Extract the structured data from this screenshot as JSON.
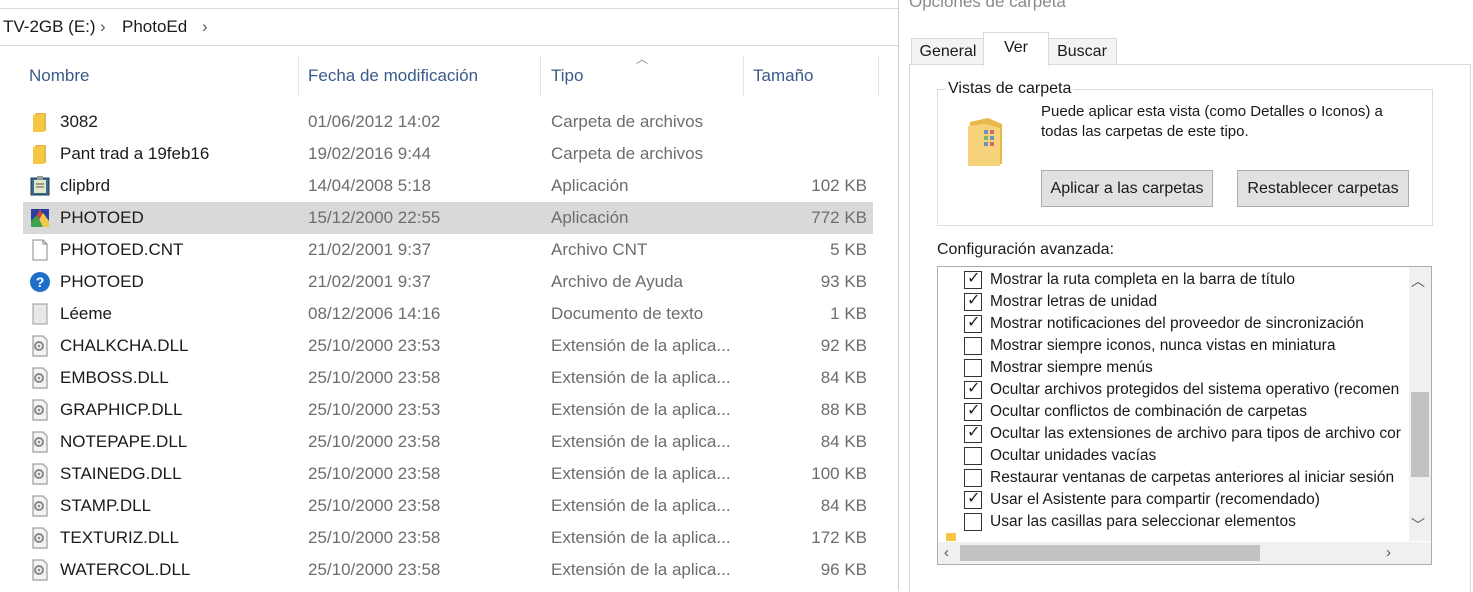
{
  "breadcrumb": {
    "drive": "TV-2GB (E:)",
    "folder": "PhotoEd"
  },
  "columns": {
    "name": "Nombre",
    "date": "Fecha de modificación",
    "type": "Tipo",
    "size": "Tamaño"
  },
  "files": [
    {
      "name": "3082",
      "date": "01/06/2012 14:02",
      "type": "Carpeta de archivos",
      "size": "",
      "icon": "folder-icon"
    },
    {
      "name": "Pant trad a 19feb16",
      "date": "19/02/2016 9:44",
      "type": "Carpeta de archivos",
      "size": "",
      "icon": "folder-icon"
    },
    {
      "name": "clipbrd",
      "date": "14/04/2008 5:18",
      "type": "Aplicación",
      "size": "102 KB",
      "icon": "clipboard-app-icon"
    },
    {
      "name": "PHOTOED",
      "date": "15/12/2000 22:55",
      "type": "Aplicación",
      "size": "772 KB",
      "icon": "photoed-app-icon"
    },
    {
      "name": "PHOTOED.CNT",
      "date": "21/02/2001 9:37",
      "type": "Archivo CNT",
      "size": "5 KB",
      "icon": "blank-file-icon"
    },
    {
      "name": "PHOTOED",
      "date": "21/02/2001 9:37",
      "type": "Archivo de Ayuda",
      "size": "93 KB",
      "icon": "help-icon"
    },
    {
      "name": "Léeme",
      "date": "08/12/2006 14:16",
      "type": "Documento de texto",
      "size": "1 KB",
      "icon": "text-file-icon"
    },
    {
      "name": "CHALKCHA.DLL",
      "date": "25/10/2000 23:53",
      "type": "Extensión de la aplica...",
      "size": "92 KB",
      "icon": "dll-file-icon"
    },
    {
      "name": "EMBOSS.DLL",
      "date": "25/10/2000 23:58",
      "type": "Extensión de la aplica...",
      "size": "84 KB",
      "icon": "dll-file-icon"
    },
    {
      "name": "GRAPHICP.DLL",
      "date": "25/10/2000 23:53",
      "type": "Extensión de la aplica...",
      "size": "88 KB",
      "icon": "dll-file-icon"
    },
    {
      "name": "NOTEPAPE.DLL",
      "date": "25/10/2000 23:58",
      "type": "Extensión de la aplica...",
      "size": "84 KB",
      "icon": "dll-file-icon"
    },
    {
      "name": "STAINEDG.DLL",
      "date": "25/10/2000 23:58",
      "type": "Extensión de la aplica...",
      "size": "100 KB",
      "icon": "dll-file-icon"
    },
    {
      "name": "STAMP.DLL",
      "date": "25/10/2000 23:58",
      "type": "Extensión de la aplica...",
      "size": "84 KB",
      "icon": "dll-file-icon"
    },
    {
      "name": "TEXTURIZ.DLL",
      "date": "25/10/2000 23:58",
      "type": "Extensión de la aplica...",
      "size": "172 KB",
      "icon": "dll-file-icon"
    },
    {
      "name": "WATERCOL.DLL",
      "date": "25/10/2000 23:58",
      "type": "Extensión de la aplica...",
      "size": "96 KB",
      "icon": "dll-file-icon"
    }
  ],
  "selected_row": 3,
  "dialog": {
    "title": "Opciones de carpeta",
    "tabs": [
      "General",
      "Ver",
      "Buscar"
    ],
    "active_tab": "Ver",
    "vistas": {
      "group_label": "Vistas de carpeta",
      "description": "Puede aplicar esta vista (como Detalles o Iconos) a todas las carpetas de este tipo.",
      "apply_button": "Aplicar a las carpetas",
      "reset_button": "Restablecer carpetas"
    },
    "advanced_label": "Configuración avanzada:",
    "options": [
      {
        "label": "Mostrar la ruta completa en la barra de título",
        "checked": true
      },
      {
        "label": "Mostrar letras de unidad",
        "checked": true
      },
      {
        "label": "Mostrar notificaciones del proveedor de sincronización",
        "checked": true
      },
      {
        "label": "Mostrar siempre iconos, nunca vistas en miniatura",
        "checked": false
      },
      {
        "label": "Mostrar siempre menús",
        "checked": false
      },
      {
        "label": "Ocultar archivos protegidos del sistema operativo (recomen",
        "checked": true
      },
      {
        "label": "Ocultar conflictos de combinación de carpetas",
        "checked": true
      },
      {
        "label": "Ocultar las extensiones de archivo para tipos de archivo cor",
        "checked": true
      },
      {
        "label": "Ocultar unidades vacías",
        "checked": false
      },
      {
        "label": "Restaurar ventanas de carpetas anteriores al iniciar sesión",
        "checked": false
      },
      {
        "label": "Usar el Asistente para compartir (recomendado)",
        "checked": true
      },
      {
        "label": "Usar las casillas para seleccionar elementos",
        "checked": false
      }
    ]
  },
  "colors": {
    "header_text": "#3a5a8a",
    "selected_row": "#d9d9d9",
    "folder": "#f6c744",
    "help_blue": "#1e6fc9"
  }
}
